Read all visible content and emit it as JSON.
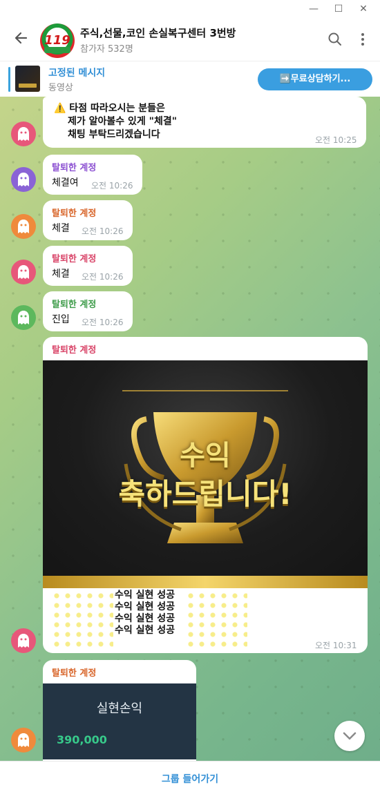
{
  "window": {
    "minimize_glyph": "—",
    "maximize_glyph": "☐",
    "close_glyph": "✕"
  },
  "header": {
    "title": "주식,선물,코인 손실복구센터 3번방",
    "subtitle": "참가자 532명",
    "logo_text": "119"
  },
  "pinned": {
    "title": "고정된 메시지",
    "subtitle": "동영상",
    "button_label": "➡️무료상담하기..."
  },
  "messages": [
    {
      "lines": [
        "⚠️ 타점 따라오시는 분들은",
        "제가 알아볼수 있게 \"체결\"",
        "채팅 부탁드리겠습니다"
      ],
      "time": "오전 10:25",
      "avatar_color": "#e7577a"
    },
    {
      "sender": "탈퇴한 계정",
      "sender_color": "#8b4fd1",
      "text": "체결여",
      "time": "오전 10:26",
      "avatar_color": "#8a63d6"
    },
    {
      "sender": "탈퇴한 계정",
      "sender_color": "#d8652a",
      "text": "체결",
      "time": "오전 10:26",
      "avatar_color": "#ef8a3c"
    },
    {
      "sender": "탈퇴한 계정",
      "sender_color": "#d94468",
      "text": "체결",
      "time": "오전 10:26",
      "avatar_color": "#e7577a"
    },
    {
      "sender": "탈퇴한 계정",
      "sender_color": "#3e9c4a",
      "text": "진입",
      "time": "오전 10:26",
      "avatar_color": "#5db85d"
    },
    {
      "sender": "탈퇴한 계정",
      "sender_color": "#d94468",
      "image_text_1": "수익",
      "image_text_2": "축하드립니다!",
      "lines": [
        "수익 실현 성공",
        "수익 실현 성공",
        "수익 실현 성공",
        "수익 실현 성공"
      ],
      "time": "오전 10:31",
      "avatar_color": "#e7577a"
    },
    {
      "sender": "탈퇴한 계정",
      "sender_color": "#d8652a",
      "image_label": "실현손익",
      "image_value": "390,000",
      "avatar_color": "#ef8a3c"
    }
  ],
  "footer": {
    "join_label": "그룹 들어가기"
  }
}
